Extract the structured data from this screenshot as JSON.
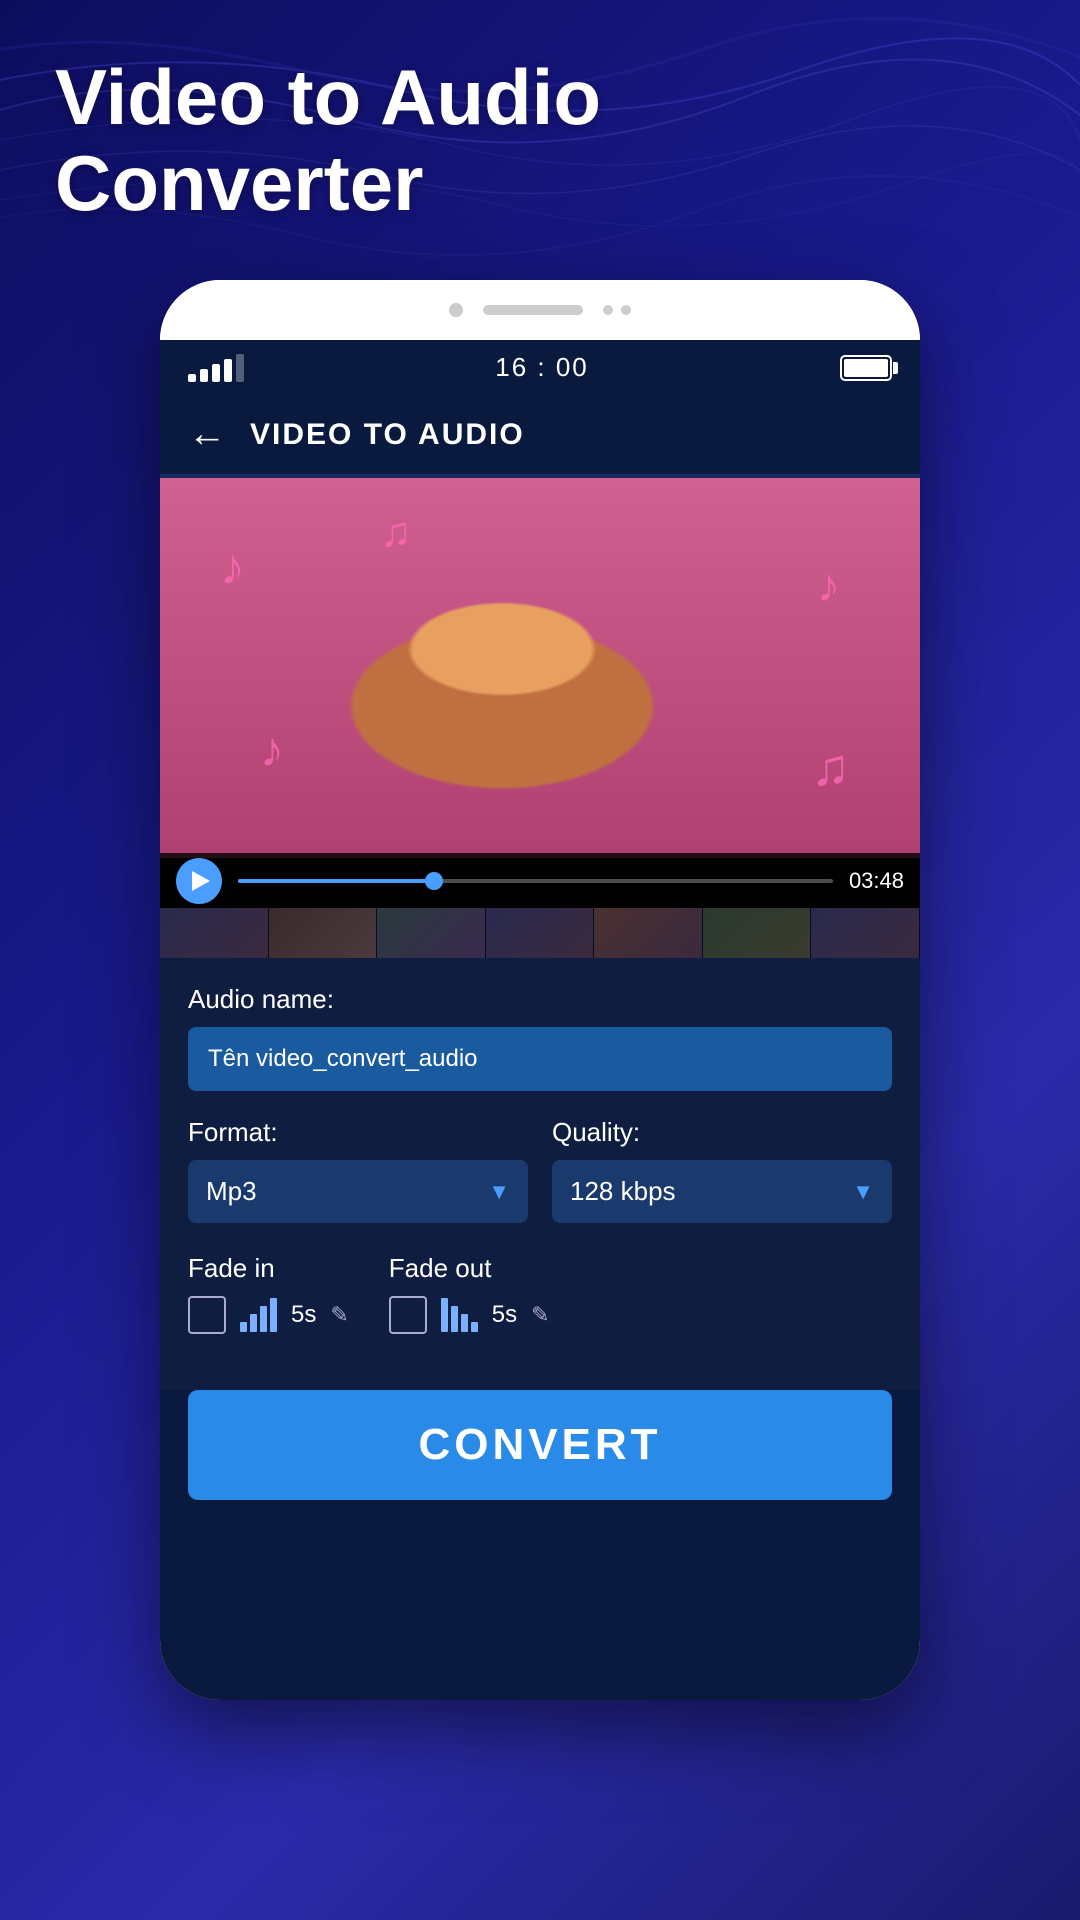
{
  "page": {
    "title": "Video to Audio Converter",
    "background_color": "#1a1a6e"
  },
  "status_bar": {
    "time": "16 : 00",
    "signal_bars": 4,
    "battery_full": true
  },
  "app_header": {
    "title": "VIDEO TO AUDIO",
    "back_label": "←"
  },
  "video_player": {
    "duration": "03:48",
    "progress_percent": 33
  },
  "form": {
    "audio_name_label": "Audio name:",
    "audio_name_value": "Tên video_convert_audio",
    "format_label": "Format:",
    "format_value": "Mp3",
    "quality_label": "Quality:",
    "quality_value": "128 kbps",
    "fade_in_label": "Fade in",
    "fade_in_time": "5s",
    "fade_out_label": "Fade out",
    "fade_out_time": "5s"
  },
  "convert_button": {
    "label": "CONVERT"
  },
  "music_notes": [
    "♪",
    "♫",
    "♪",
    "♫"
  ]
}
